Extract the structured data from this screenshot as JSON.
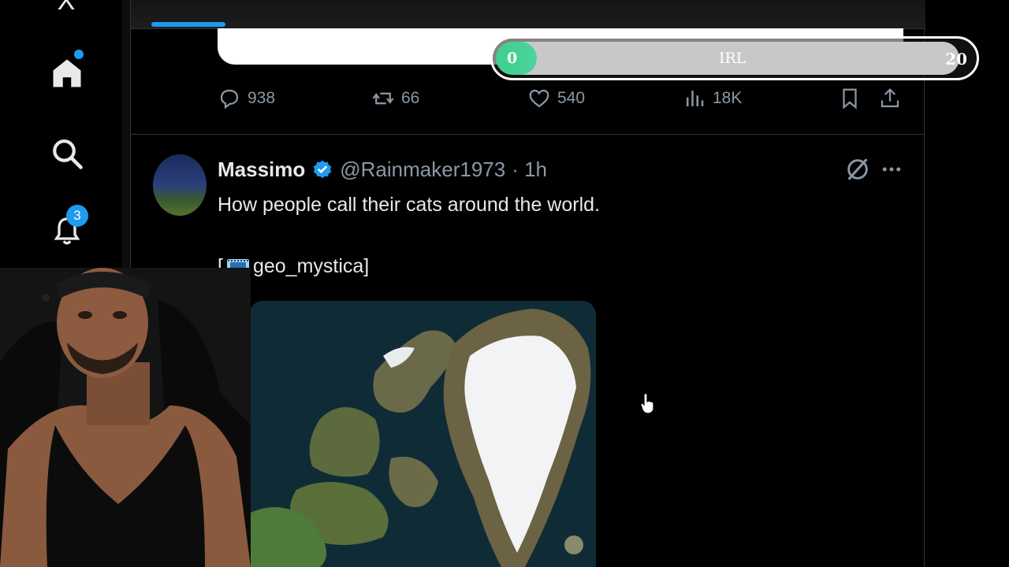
{
  "nav": {
    "logo": "X",
    "notifications_count": "3"
  },
  "overlay": {
    "min": "0",
    "label": "IRL",
    "max": "20",
    "progress_fraction": 0
  },
  "previous_post": {
    "replies": "938",
    "reposts": "66",
    "likes": "540",
    "views": "18K"
  },
  "tweet": {
    "author": "Massimo",
    "handle": "@Rainmaker1973",
    "time": "· 1h",
    "text": "How people call their cats around the world.",
    "credit_open": "[",
    "credit_handle": "geo_mystica]"
  },
  "colors": {
    "accent": "#1d9bf0",
    "irl_fill": "#3fcf8e"
  }
}
